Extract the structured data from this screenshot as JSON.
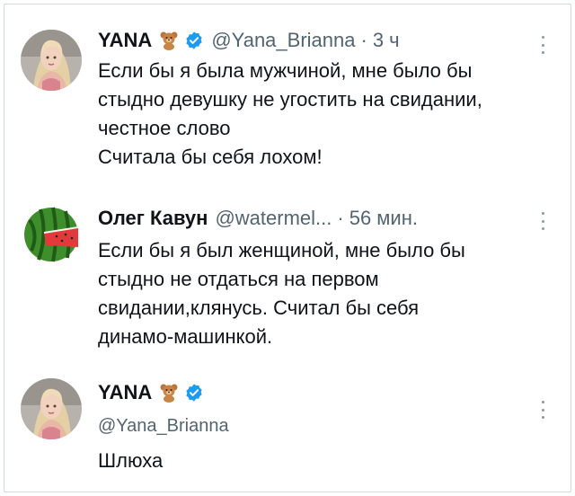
{
  "posts": [
    {
      "name": "YANA",
      "handle": "@Yana_Brianna",
      "separator": "·",
      "time": "3 ч",
      "lines": [
        "Если бы я была мужчиной, мне было бы",
        "стыдно девушку не угостить на свидании,",
        "честное слово",
        "Считала бы себя лохом!"
      ]
    },
    {
      "name": "Олег Кавун",
      "handle": "@watermel...",
      "separator": "·",
      "time": "56 мин.",
      "lines": [
        "Если бы я был женщиной, мне было бы",
        "стыдно не отдаться на первом",
        "свидании,клянусь. Считал бы себя",
        "динамо-машинкой."
      ]
    },
    {
      "name": "YANA",
      "handle": "@Yana_Brianna",
      "lines": [
        "Шлюха"
      ]
    }
  ],
  "icons": {
    "emoji": "teddy-bear-icon",
    "badge": "verified-badge-icon",
    "menu": "more-options-icon"
  },
  "colors": {
    "text": "#0f1419",
    "secondary": "#536471",
    "verified": "#1d9bf0",
    "border": "#cfd9de"
  }
}
